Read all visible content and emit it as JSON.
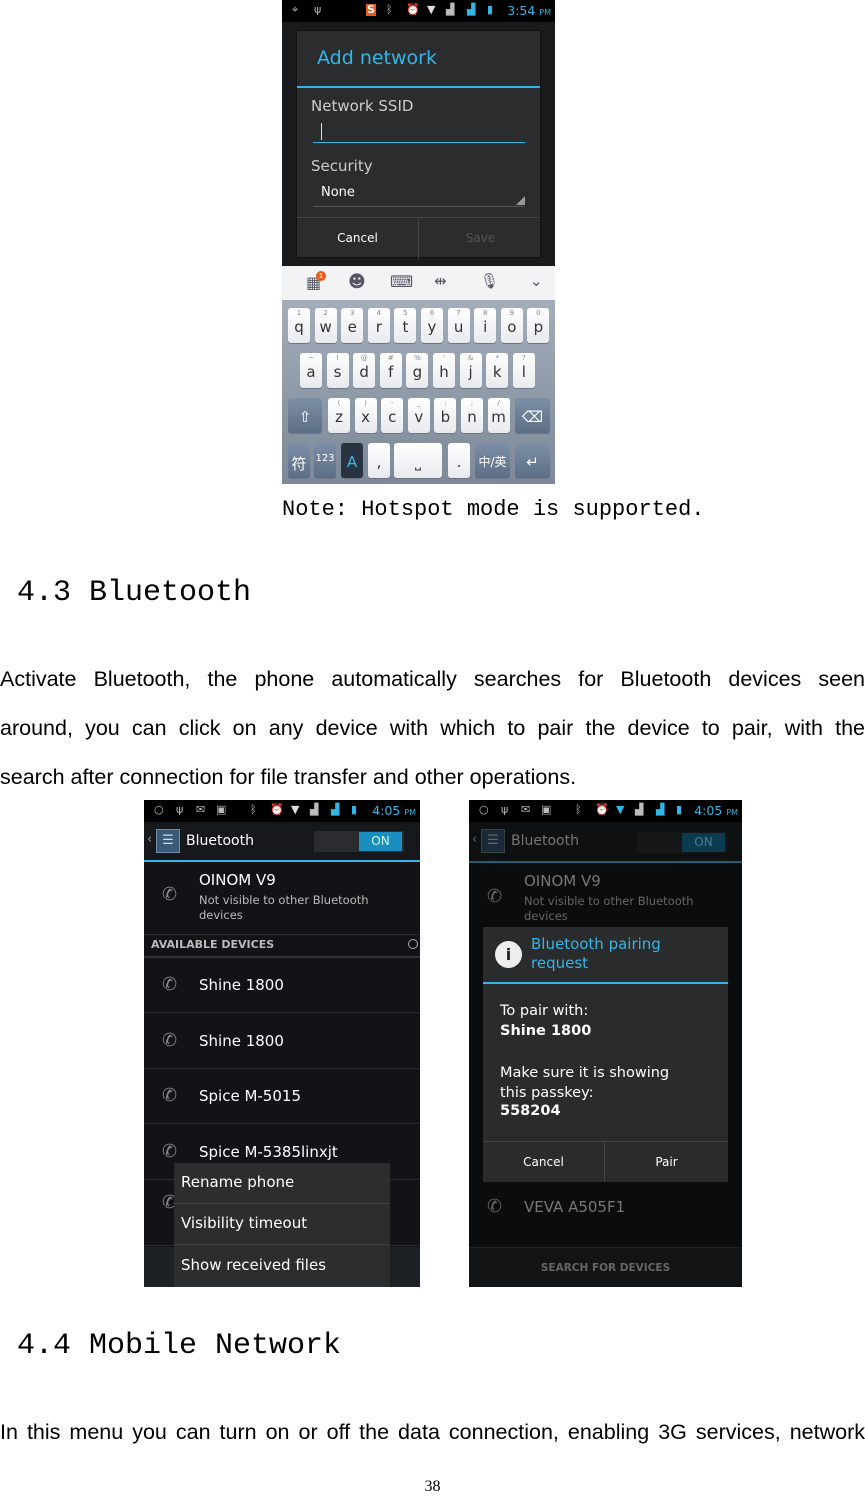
{
  "wifi_screen": {
    "status_time": "3:54",
    "status_ampm": "PM",
    "dialog_title": "Add network",
    "ssid_label": "Network SSID",
    "ssid_value": "",
    "security_label": "Security",
    "security_value": "None",
    "cancel": "Cancel",
    "save": "Save",
    "accent": "#33b5e5",
    "keyboard": {
      "toolbar_icons": [
        "apps-icon",
        "emoji-icon",
        "keyboard-icon",
        "cursor-icon",
        "mic-icon",
        "chevron-down-icon"
      ],
      "badge": "1",
      "row1": [
        [
          "1",
          "q"
        ],
        [
          "2",
          "w"
        ],
        [
          "3",
          "e"
        ],
        [
          "4",
          "r"
        ],
        [
          "5",
          "t"
        ],
        [
          "6",
          "y"
        ],
        [
          "7",
          "u"
        ],
        [
          "8",
          "i"
        ],
        [
          "9",
          "o"
        ],
        [
          "0",
          "p"
        ]
      ],
      "row2": [
        [
          "~",
          "a"
        ],
        [
          "!",
          "s"
        ],
        [
          "@",
          "d"
        ],
        [
          "#",
          "f"
        ],
        [
          "%",
          "g"
        ],
        [
          "'",
          "h"
        ],
        [
          "&",
          "j"
        ],
        [
          "*",
          "k"
        ],
        [
          "?",
          "l"
        ]
      ],
      "row3": [
        [
          "(",
          "z"
        ],
        [
          ")",
          "x"
        ],
        [
          "-",
          "c"
        ],
        [
          "_",
          "v"
        ],
        [
          ":",
          "b"
        ],
        [
          ";",
          "n"
        ],
        [
          "/",
          "m"
        ]
      ],
      "sym": "符",
      "num": "123",
      "comma": ",",
      "period": ".",
      "lang": "中/英"
    }
  },
  "caption": "Note: Hotspot mode is supported.",
  "section_43": {
    "heading": "4.3 Bluetooth",
    "lines": [
      "Activate Bluetooth, the phone automatically searches for Bluetooth devices seen",
      "around, you can click on any device with which to pair the device to pair, with the",
      "search after connection for file transfer and other operations."
    ]
  },
  "bt_screen": {
    "status_time": "4:05",
    "status_ampm": "PM",
    "title": "Bluetooth",
    "toggle": "ON",
    "own_device": "OINOM V9",
    "own_status": "Not visible to other Bluetooth devices",
    "section": "AVAILABLE DEVICES",
    "devices": [
      "Shine 1800",
      "Shine 1800",
      "Spice M-5015",
      "Spice M-5385linxjt"
    ],
    "menu": [
      "Rename phone",
      "Visibility timeout",
      "Show received files"
    ]
  },
  "pair_screen": {
    "status_time": "4:05",
    "status_ampm": "PM",
    "title": "Bluetooth",
    "toggle": "ON",
    "own_device": "OINOM V9",
    "own_status": "Not visible to other Bluetooth devices",
    "dialog_title": "Bluetooth pairing request",
    "pair_with": "To pair with:",
    "device": "Shine 1800",
    "make_sure": "Make sure it is showing this passkey:",
    "passkey": "558204",
    "cancel": "Cancel",
    "pair": "Pair",
    "other_device": "VEVA A505F1",
    "search": "SEARCH FOR DEVICES"
  },
  "section_44": {
    "heading": "4.4 Mobile Network",
    "lines": [
      "In this menu you can turn on or off the data connection, enabling 3G services, network"
    ]
  },
  "page_number": "38"
}
